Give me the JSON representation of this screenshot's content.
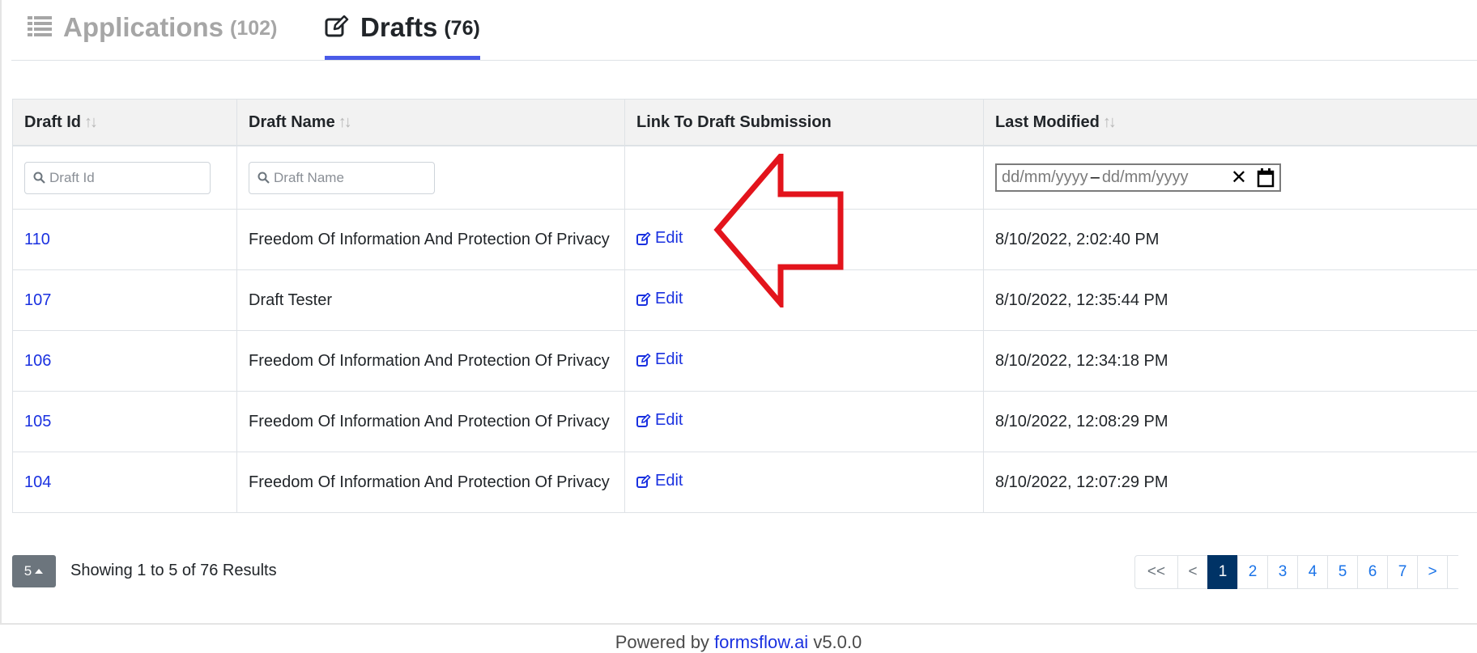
{
  "tabs": [
    {
      "label": "Applications",
      "count": "(102)",
      "icon": "list-icon",
      "active": false
    },
    {
      "label": "Drafts",
      "count": "(76)",
      "icon": "edit-icon",
      "active": true
    }
  ],
  "table": {
    "columns": [
      {
        "label": "Draft Id",
        "sortable": true
      },
      {
        "label": "Draft Name",
        "sortable": true
      },
      {
        "label": "Link To Draft Submission",
        "sortable": false
      },
      {
        "label": "Last Modified",
        "sortable": true
      }
    ],
    "sort_icon": "↑↓",
    "filters": {
      "draft_id_placeholder": "Draft Id",
      "draft_name_placeholder": "Draft Name",
      "date_range": {
        "from": "dd/mm/yyyy",
        "separator": "–",
        "to": "dd/mm/yyyy",
        "clear": "✕"
      }
    },
    "rows": [
      {
        "id": "110",
        "name": "Freedom Of Information And Protection Of Privacy",
        "link": "Edit",
        "modified": "8/10/2022, 2:02:40 PM"
      },
      {
        "id": "107",
        "name": "Draft Tester",
        "link": "Edit",
        "modified": "8/10/2022, 12:35:44 PM"
      },
      {
        "id": "106",
        "name": "Freedom Of Information And Protection Of Privacy",
        "link": "Edit",
        "modified": "8/10/2022, 12:34:18 PM"
      },
      {
        "id": "105",
        "name": "Freedom Of Information And Protection Of Privacy",
        "link": "Edit",
        "modified": "8/10/2022, 12:08:29 PM"
      },
      {
        "id": "104",
        "name": "Freedom Of Information And Protection Of Privacy",
        "link": "Edit",
        "modified": "8/10/2022, 12:07:29 PM"
      }
    ]
  },
  "pagination": {
    "page_size": "5",
    "results_text": "Showing 1 to 5 of 76 Results",
    "first": "<<",
    "prev": "<",
    "pages": [
      "1",
      "2",
      "3",
      "4",
      "5",
      "6",
      "7"
    ],
    "active_page": "1",
    "next": ">"
  },
  "footer": {
    "prefix": "Powered by ",
    "brand": "formsflow.ai",
    "version": " v5.0.0"
  },
  "colors": {
    "link": "#1a31e0",
    "tab_underline": "#4a5be8",
    "active_page": "#003366",
    "annotation_arrow": "#e3141c"
  }
}
